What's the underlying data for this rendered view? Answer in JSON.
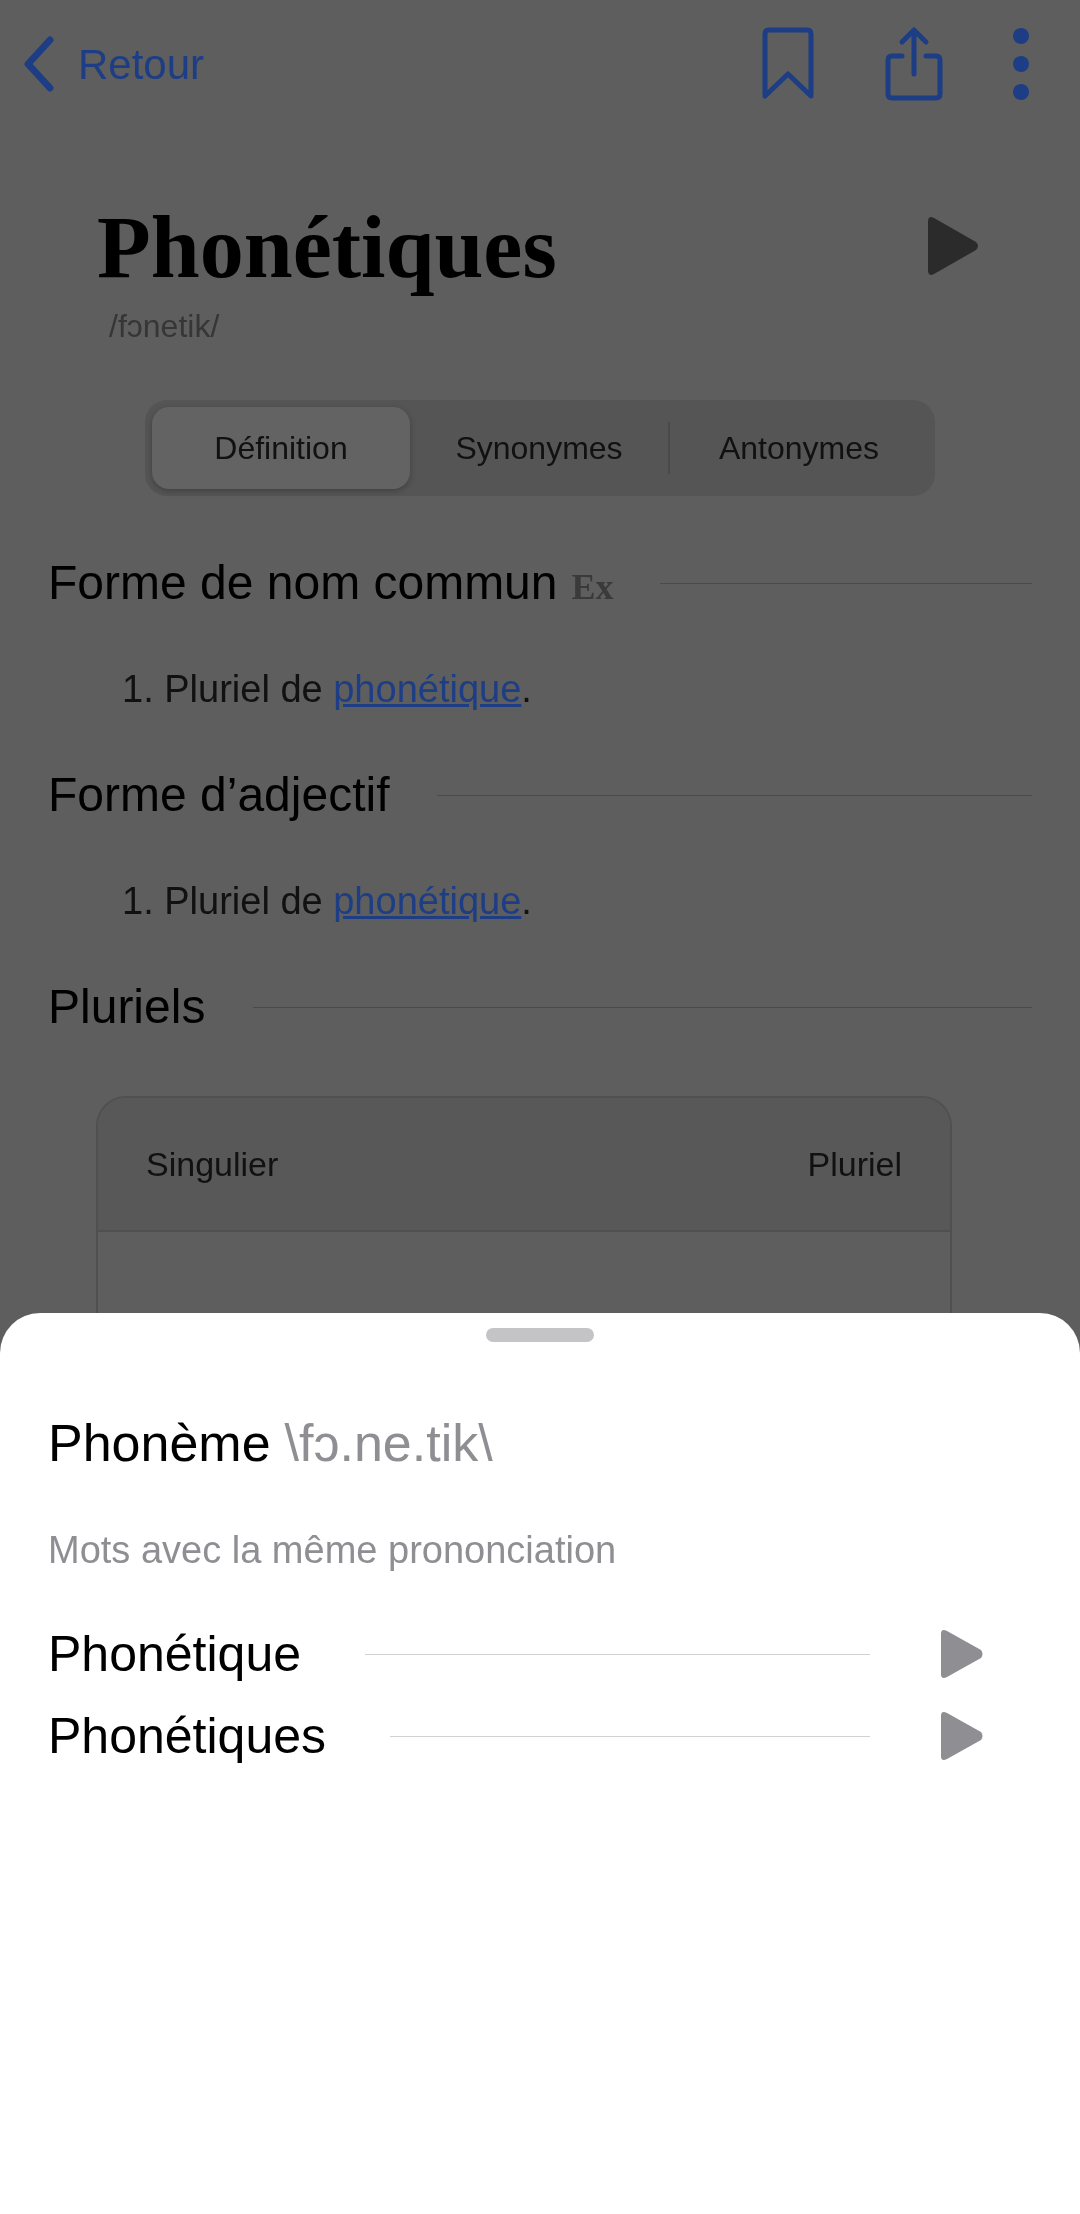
{
  "nav": {
    "back_label": "Retour"
  },
  "headword": {
    "title": "Phonétiques",
    "pronunciation": "/fɔnetik/"
  },
  "tabs": [
    {
      "label": "Définition",
      "selected": true
    },
    {
      "label": "Synonymes",
      "selected": false
    },
    {
      "label": "Antonymes",
      "selected": false
    }
  ],
  "sections": [
    {
      "kind": "definitions",
      "heading": "Forme de nom commun",
      "badge": "Ex",
      "items": [
        {
          "number": "1.",
          "text": "Pluriel de ",
          "link": "phonétique",
          "after": "."
        }
      ]
    },
    {
      "kind": "definitions",
      "heading": "Forme d’adjectif",
      "items": [
        {
          "number": "1.",
          "text": "Pluriel de ",
          "link": "phonétique",
          "after": "."
        }
      ]
    },
    {
      "kind": "table",
      "heading": "Pluriels",
      "table": {
        "columns": [
          "Singulier",
          "Pluriel"
        ]
      }
    }
  ],
  "sheet": {
    "title": "Phonème",
    "ipa": "\\fɔ.ne.tik\\",
    "subtitle": "Mots avec la même prononciation",
    "words": [
      {
        "word": "Phonétique"
      },
      {
        "word": "Phonétiques"
      }
    ]
  }
}
